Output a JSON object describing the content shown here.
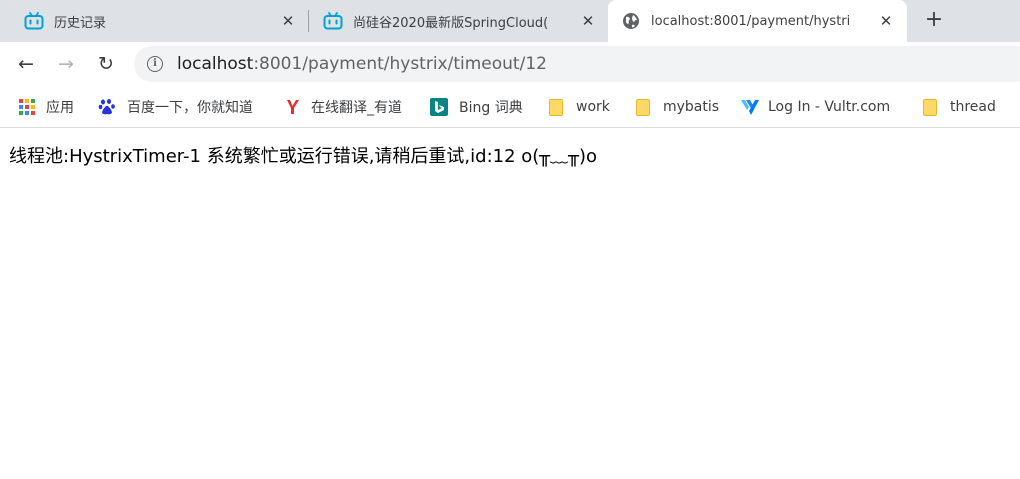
{
  "tabs": [
    {
      "title": "历史记录",
      "icon": "bilibili-icon",
      "close": "✕"
    },
    {
      "title": "尚硅谷2020最新版SpringCloud(",
      "icon": "bilibili-icon",
      "close": "✕"
    },
    {
      "title": "localhost:8001/payment/hystri",
      "icon": "globe-icon",
      "close": "✕",
      "active": true
    }
  ],
  "new_tab_label": "+",
  "toolbar": {
    "back": "←",
    "forward": "→",
    "reload": "↻",
    "info": "i",
    "url_host": "localhost",
    "url_rest": ":8001/payment/hystrix/timeout/12"
  },
  "bookmarks": [
    {
      "label": "应用",
      "icon": "apps-grid-icon"
    },
    {
      "label": "百度一下，你就知道",
      "icon": "baidu-paw-icon"
    },
    {
      "label": "在线翻译_有道",
      "icon": "youdao-icon"
    },
    {
      "label": "Bing 词典",
      "icon": "bing-icon"
    },
    {
      "label": "work",
      "icon": "folder-icon"
    },
    {
      "label": "mybatis",
      "icon": "folder-icon"
    },
    {
      "label": "Log In - Vultr.com",
      "icon": "vultr-icon"
    },
    {
      "label": "thread",
      "icon": "folder-icon"
    }
  ],
  "page": {
    "message": "线程池:HystrixTimer-1 系统繁忙或运行错误,请稍后重试,id:12 o(╥﹏╥)o"
  },
  "colors": {
    "tabstrip": "#dee1e6",
    "bilibili": "#00a1d6",
    "omnibox": "#f1f3f4",
    "folder": "#fcd867"
  }
}
